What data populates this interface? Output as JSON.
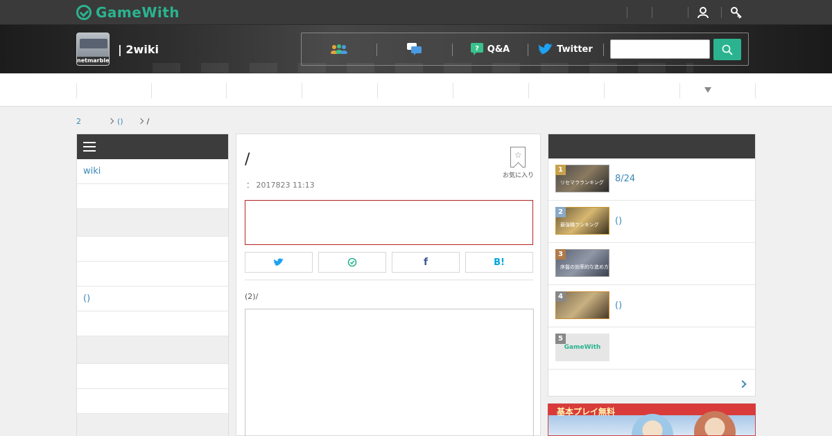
{
  "site": {
    "brand": "GameWith",
    "wiki_title": "| 2wiki",
    "game_logo_text": "netmarble"
  },
  "header_nav": [
    {
      "label": "",
      "icon": "community-icon"
    },
    {
      "label": "",
      "icon": "chat-icon"
    },
    {
      "label": "Q&A",
      "icon": "qa-icon"
    },
    {
      "label": "Twitter",
      "icon": "twitter-icon"
    }
  ],
  "search": {
    "placeholder": ""
  },
  "breadcrumb": [
    {
      "label": "2"
    },
    {
      "label": "()"
    },
    {
      "label": "/"
    }
  ],
  "left_menu": [
    {
      "label": "wiki"
    },
    {
      "label": ""
    },
    {
      "label": ""
    },
    {
      "label": ""
    },
    {
      "label": ""
    },
    {
      "label": "()"
    },
    {
      "label": ""
    },
    {
      "label": ""
    },
    {
      "label": ""
    },
    {
      "label": ""
    },
    {
      "label": ""
    }
  ],
  "article": {
    "title": "/",
    "favorite_label": "お気に入り",
    "meta": "：  2017823 11:13",
    "section_label": "(2)/"
  },
  "share_buttons": [
    {
      "icon": "twitter-icon",
      "color": "#1da1f2"
    },
    {
      "icon": "line-icon",
      "color": "#2bb38f"
    },
    {
      "label": "f",
      "icon": "facebook-icon",
      "color": "#3b5998"
    },
    {
      "label": "B!",
      "icon": "hatena-icon",
      "color": "#00a4de"
    }
  ],
  "ranking": [
    {
      "rank": "1",
      "text": "8/24",
      "badge_color": "#c8a24a",
      "thumb_caption": "リセマラランキング"
    },
    {
      "rank": "2",
      "text": "()",
      "badge_color": "#8aa9c7",
      "thumb_caption": "最強職ランキング"
    },
    {
      "rank": "3",
      "text": "",
      "badge_color": "#b07a4a",
      "thumb_caption": "序盤の効率的な進め方"
    },
    {
      "rank": "4",
      "text": "()",
      "badge_color": "#888888",
      "thumb_caption": ""
    },
    {
      "rank": "5",
      "text": "",
      "badge_color": "#888888",
      "thumb_caption": "GameWith"
    }
  ],
  "ad": {
    "headline": "基本プレイ無料"
  },
  "colors": {
    "accent": "#2bb38f",
    "link": "#3a88b8",
    "dark": "#3a3a3a",
    "alert": "#b22222"
  }
}
